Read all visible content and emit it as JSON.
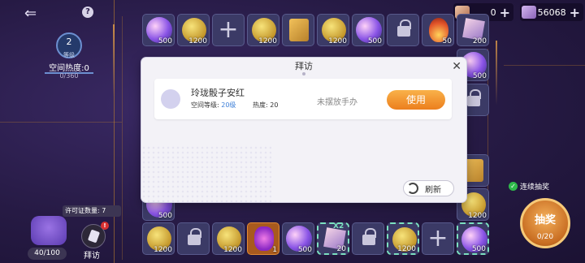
{
  "topbar": {
    "back_icon": "back-arrow-icon",
    "help_icon": "help-icon",
    "help_glyph": "?",
    "currency1": {
      "value": "0",
      "icon": "ticket-icon"
    },
    "currency2": {
      "value": "56068",
      "icon": "gem-icon"
    },
    "plus": "+"
  },
  "player": {
    "level": "2",
    "level_unit": "等级",
    "space_heat": "空间热度:0",
    "heat_progress": "0/360"
  },
  "grid": {
    "row1": [
      {
        "type": "orb",
        "count": "500"
      },
      {
        "type": "coin",
        "count": "1200"
      },
      {
        "type": "add",
        "count": ""
      },
      {
        "type": "coin",
        "count": "1200"
      },
      {
        "type": "book",
        "count": ""
      },
      {
        "type": "coin",
        "count": "1200"
      },
      {
        "type": "orb",
        "count": "500"
      },
      {
        "type": "lock",
        "count": ""
      },
      {
        "type": "fire",
        "count": "50"
      },
      {
        "type": "box",
        "count": "200"
      }
    ],
    "right_col": [
      {
        "type": "orb",
        "count": "500"
      },
      {
        "type": "lock",
        "count": ""
      },
      {
        "type": "book",
        "count": ""
      },
      {
        "type": "coin",
        "count": "1200"
      }
    ],
    "left_col": [
      {
        "type": "orb",
        "count": "500"
      }
    ],
    "bottom_row": [
      {
        "type": "coin",
        "count": "1200"
      },
      {
        "type": "lock",
        "count": ""
      },
      {
        "type": "coin",
        "count": "1200"
      },
      {
        "type": "feather",
        "count": "1"
      },
      {
        "type": "orb",
        "count": "500"
      },
      {
        "type": "box",
        "count": "20"
      },
      {
        "type": "lock",
        "count": ""
      },
      {
        "type": "coin",
        "count": "1200"
      },
      {
        "type": "add",
        "count": ""
      },
      {
        "type": "orb",
        "count": "500"
      }
    ],
    "multiplier": "X2"
  },
  "permit": {
    "label": "许可证数量: 7"
  },
  "bag": {
    "count": "40/100"
  },
  "visit": {
    "label": "拜访",
    "badge": "!"
  },
  "draw": {
    "label": "抽奖",
    "progress": "0/20",
    "auto_label": "连续抽奖",
    "auto_check": "✓"
  },
  "modal": {
    "title": "拜访",
    "close": "✕",
    "friend": {
      "name": "玲珑骰子安红",
      "level_prefix": "空间等级: ",
      "level_value": "20级",
      "heat": "热度: 20",
      "status": "未摆放手办",
      "use_label": "使用"
    },
    "refresh_label": "刷新"
  },
  "colors": {
    "accent": "#ec7f1d",
    "level_blue": "#3d7fd8",
    "bg": "#2a1d4a"
  }
}
